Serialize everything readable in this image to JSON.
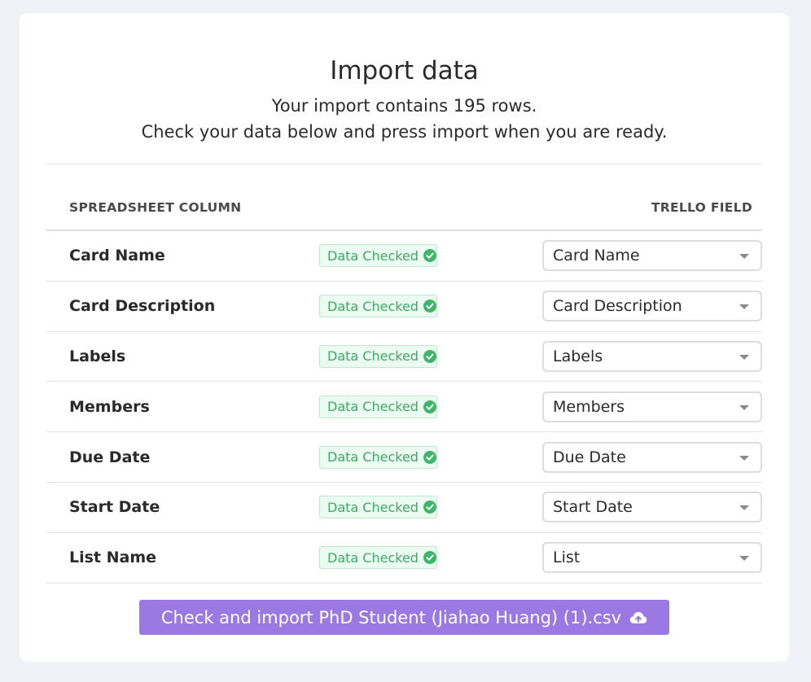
{
  "dialog": {
    "title": "Import data",
    "subtitle_line1": "Your import contains 195 rows.",
    "subtitle_line2": "Check your data below and press import when you are ready."
  },
  "table": {
    "header_left": "SPREADSHEET COLUMN",
    "header_right": "TRELLO FIELD",
    "rows": [
      {
        "column": "Card Name",
        "status": "Data Checked",
        "field": "Card Name"
      },
      {
        "column": "Card Description",
        "status": "Data Checked",
        "field": "Card Description"
      },
      {
        "column": "Labels",
        "status": "Data Checked",
        "field": "Labels"
      },
      {
        "column": "Members",
        "status": "Data Checked",
        "field": "Members"
      },
      {
        "column": "Due Date",
        "status": "Data Checked",
        "field": "Due Date"
      },
      {
        "column": "Start Date",
        "status": "Data Checked",
        "field": "Start Date"
      },
      {
        "column": "List Name",
        "status": "Data Checked",
        "field": "List"
      }
    ]
  },
  "import_button": {
    "label": "Check and import PhD Student (Jiahao Huang) (1).csv",
    "icon": "cloud-upload-icon"
  },
  "colors": {
    "background": "#f1f2f7",
    "accent": "#9b79e3",
    "success": "#3fa866",
    "success_bg": "#ebfbf1"
  }
}
